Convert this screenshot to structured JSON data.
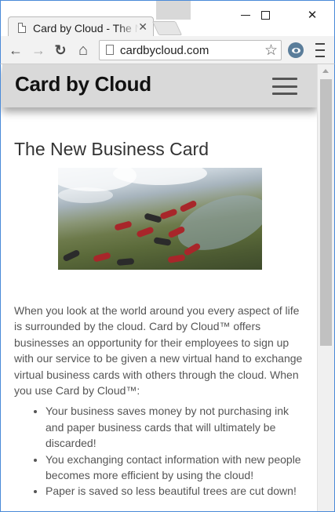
{
  "browser": {
    "tab_title": "Card by Cloud - The New Business Card",
    "tab_close": "✕",
    "url": "cardbycloud.com",
    "window_controls": {
      "minimize": "minimize-icon",
      "maximize": "maximize-icon",
      "close": "✕"
    },
    "nav_icons": {
      "back": "←",
      "forward": "→",
      "reload": "↻",
      "home": "⌂",
      "bookmark": "☆"
    }
  },
  "site": {
    "title": "Card by Cloud",
    "menu_icon": "hamburger-icon"
  },
  "article": {
    "heading": "The New Business Card",
    "hero_alt": "skydivers-in-formation-image",
    "paragraph": "When you look at the world around you every aspect of life is surrounded by the cloud. Card by Cloud™ offers businesses an opportunity for their employees to sign up with our service to be given a new virtual hand to exchange virtual business cards with others through the cloud. When you use Card by Cloud™:",
    "benefits": [
      "Your business saves money by not purchasing ink and paper business cards that will ultimately be discarded!",
      "You exchanging contact information with new people becomes more efficient by using the cloud!",
      "Paper is saved so less beautiful trees are cut down!"
    ]
  },
  "colors": {
    "window_border": "#4a8ad8",
    "header_bg": "#d9d9d9",
    "text": "#555555"
  }
}
